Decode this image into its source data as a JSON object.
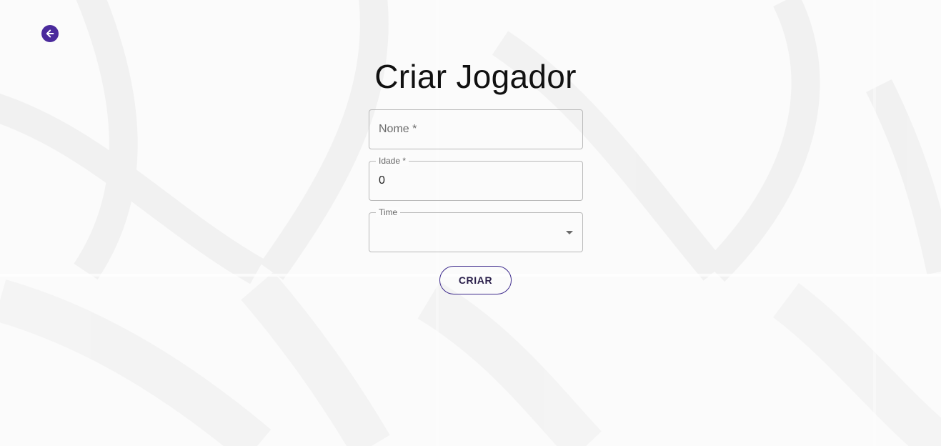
{
  "page": {
    "title": "Criar Jogador"
  },
  "nav": {
    "back_icon": "arrow-left-icon"
  },
  "form": {
    "nome": {
      "placeholder": "Nome *",
      "value": ""
    },
    "idade": {
      "label": "Idade *",
      "value": "0"
    },
    "time": {
      "label": "Time",
      "value": "",
      "icon": "chevron-down-icon"
    },
    "submit_label": "CRIAR"
  },
  "colors": {
    "accent": "#4a2a9c",
    "button_border": "#3d2a8c"
  }
}
